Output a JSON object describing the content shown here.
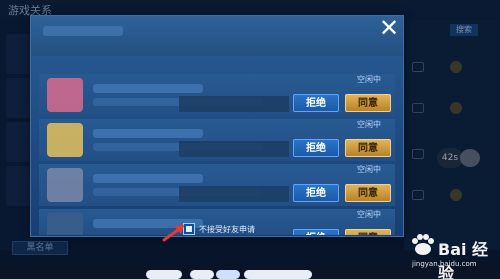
{
  "background": {
    "title": "游戏关系",
    "right_button": "搜索",
    "blacklist_label": "黑名单",
    "timer_text": "42s"
  },
  "modal": {
    "rows": [
      {
        "status": "空闲中",
        "reject": "拒绝",
        "accept": "同意",
        "avatar_color": "#d96b8f"
      },
      {
        "status": "空闲中",
        "reject": "拒绝",
        "accept": "同意",
        "avatar_color": "#e5c15c"
      },
      {
        "status": "空闲中",
        "reject": "拒绝",
        "accept": "同意",
        "avatar_color": "#7a88a8"
      },
      {
        "status": "空闲中",
        "reject": "拒绝",
        "accept": "同意",
        "avatar_color": "#3b5f8b"
      }
    ],
    "checkbox_label": "不接受好友申请"
  },
  "watermark": {
    "brand": "Bai 经验",
    "url": "jingyan.baidu.com"
  },
  "colors": {
    "accept": "#c8922f",
    "reject": "#1f63b8",
    "arrow": "#e53935"
  }
}
